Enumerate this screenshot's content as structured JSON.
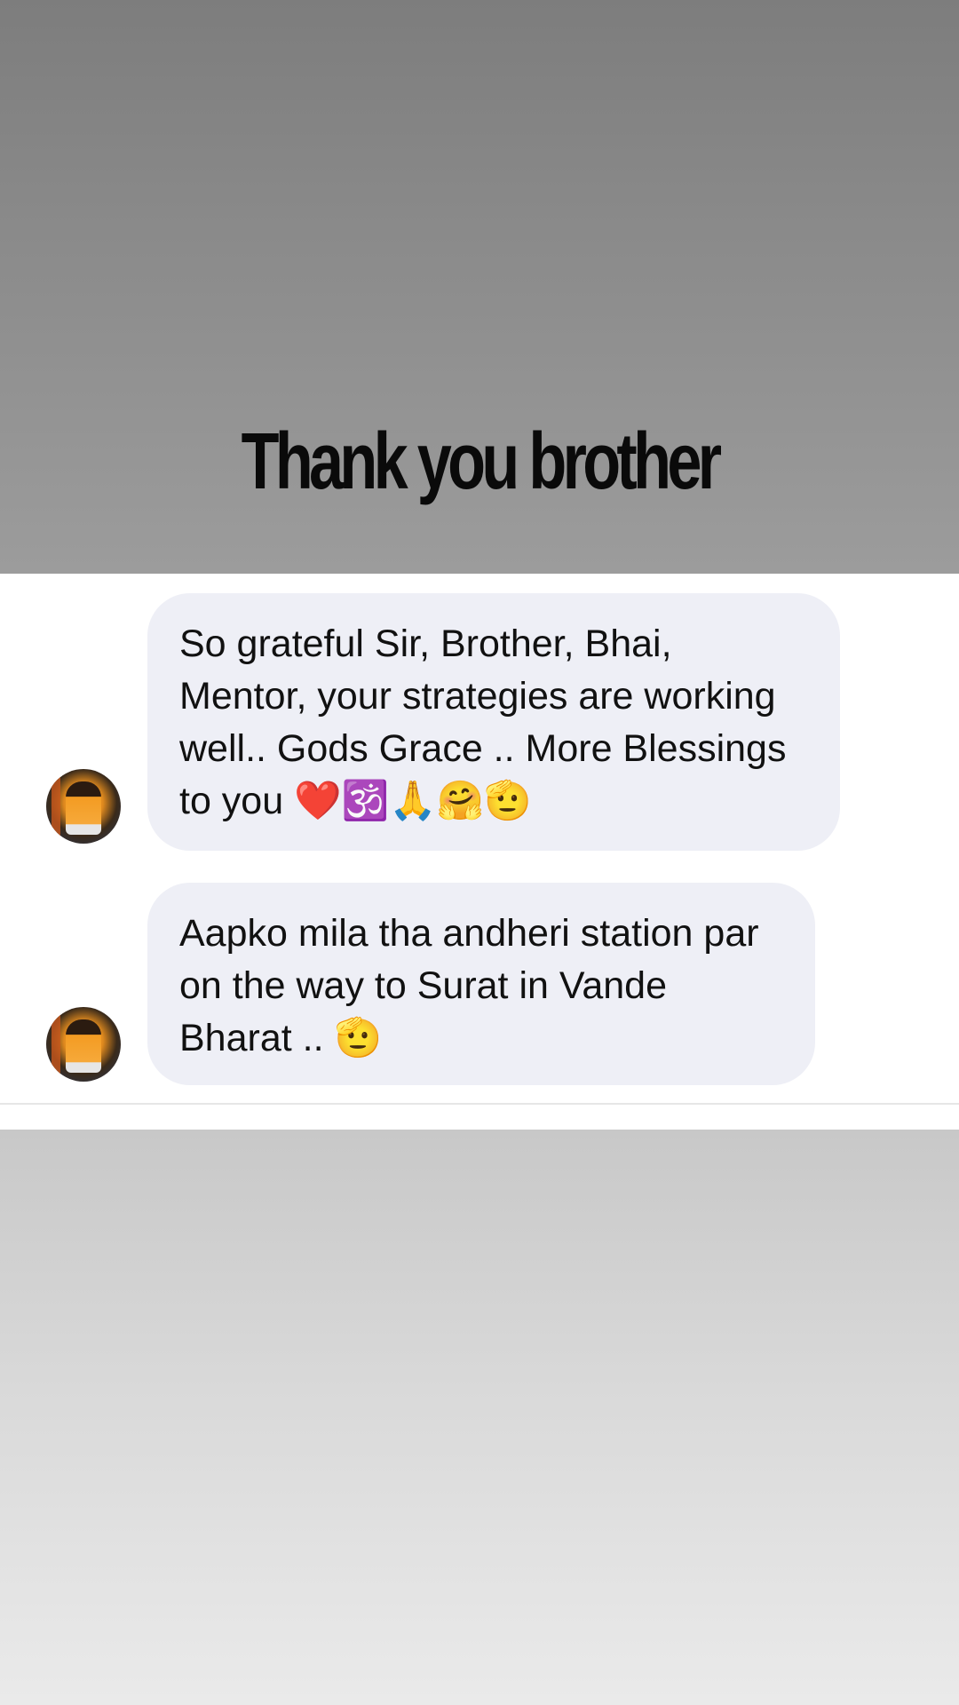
{
  "overlay": {
    "caption": "Thank you brother"
  },
  "colors": {
    "bubble_background": "#eeeff6",
    "text": "#111111",
    "top_band": "#8a8a8a",
    "bottom_band": "#d9d9d9"
  },
  "messages": [
    {
      "avatar_icon": "profile-avatar",
      "text": "So grateful Sir, Brother, Bhai, Mentor, your strategies are working well.. Gods Grace .. More Blessings to you",
      "emojis": "❤️🕉️🙏🤗🫡"
    },
    {
      "avatar_icon": "profile-avatar",
      "text": "Aapko mila tha andheri station par on the way to Surat in Vande Bharat ..",
      "emojis": "🫡"
    }
  ]
}
